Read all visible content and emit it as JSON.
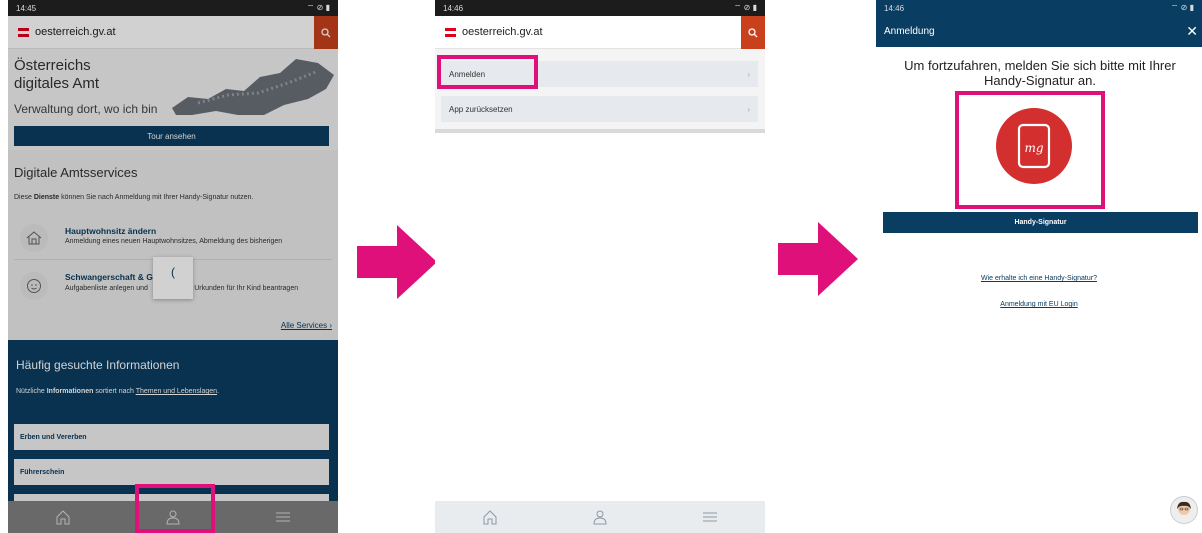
{
  "screen1": {
    "status_time": "14:45",
    "site_name": "oesterreich.gv.at",
    "hero_title_1": "Österreichs",
    "hero_title_2": "digitales Amt",
    "hero_subtitle": "Verwaltung dort, wo ich bin",
    "tour_button": "Tour ansehen",
    "services_heading": "Digitale Amtsservices",
    "services_intro_pre": "Diese ",
    "services_intro_bold": "Dienste",
    "services_intro_post": " können Sie nach Anmeldung mit Ihrer Handy-Signatur nutzen.",
    "services": [
      {
        "title": "Hauptwohnsitz ändern",
        "desc": "Anmeldung eines neuen Hauptwohnsitzes, Abmeldung des bisherigen",
        "icon": "house-icon"
      },
      {
        "title": "Schwangerschaft & G",
        "desc": "Aufgabenliste anlegen und         llung der Urkunden für Ihr Kind beantragen",
        "icon": "baby-icon"
      }
    ],
    "loading_glyph": "(",
    "all_services": "Alle Services",
    "info_heading": "Häufig gesuchte Informationen",
    "info_intro_pre": "Nützliche ",
    "info_intro_bold": "Informationen",
    "info_intro_mid": " sortiert nach ",
    "info_link": "Themen und Lebenslagen",
    "info_intro_end": ".",
    "info_items": [
      "Erben und Vererben",
      "Führerschein"
    ]
  },
  "screen2": {
    "status_time": "14:46",
    "site_name": "oesterreich.gv.at",
    "menu": [
      "Anmelden",
      "App zurücksetzen"
    ]
  },
  "screen3": {
    "status_time": "14:46",
    "title": "Anmeldung",
    "message": "Um fortzufahren, melden Sie sich bitte mit Ihrer Handy-Signatur an.",
    "signature_button": "Handy-Signatur",
    "link_how": "Wie erhalte ich eine Handy-Signatur?",
    "link_eu": "Anmeldung mit EU Login"
  },
  "colors": {
    "highlight": "#e0107a",
    "navy": "#0a3d62",
    "brand_red": "#e3001b"
  }
}
